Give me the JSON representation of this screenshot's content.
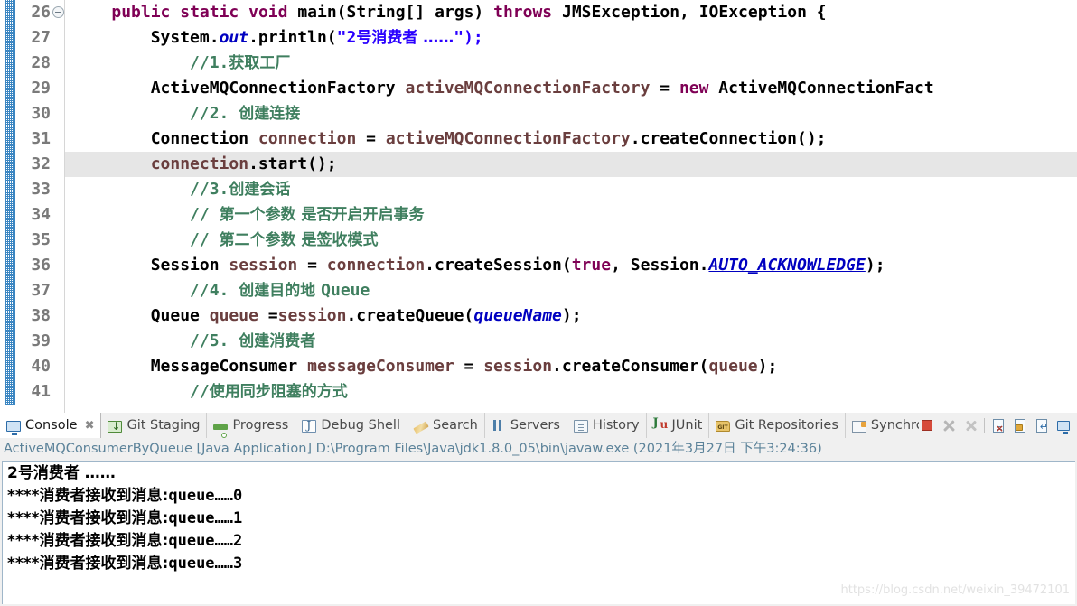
{
  "editor": {
    "lines": [
      {
        "number": "26",
        "folded": true,
        "highlighted": false,
        "tokens": [
          {
            "t": "    ",
            "c": "pln"
          },
          {
            "t": "public",
            "c": "kw"
          },
          {
            "t": " ",
            "c": "pln"
          },
          {
            "t": "static",
            "c": "kw"
          },
          {
            "t": " ",
            "c": "pln"
          },
          {
            "t": "void",
            "c": "kw"
          },
          {
            "t": " ",
            "c": "pln"
          },
          {
            "t": "main",
            "c": "typ"
          },
          {
            "t": "(",
            "c": "pln"
          },
          {
            "t": "String",
            "c": "typ"
          },
          {
            "t": "[] ",
            "c": "pln"
          },
          {
            "t": "args",
            "c": "typ"
          },
          {
            "t": ") ",
            "c": "pln"
          },
          {
            "t": "throws",
            "c": "kw"
          },
          {
            "t": " ",
            "c": "pln"
          },
          {
            "t": "JMSException, IOException {",
            "c": "typ"
          }
        ]
      },
      {
        "number": "27",
        "folded": false,
        "highlighted": false,
        "tokens": [
          {
            "t": "        ",
            "c": "pln"
          },
          {
            "t": "System",
            "c": "typ"
          },
          {
            "t": ".",
            "c": "pln"
          },
          {
            "t": "out",
            "c": "fld"
          },
          {
            "t": ".println(",
            "c": "pln"
          },
          {
            "t": "\"2",
            "c": "str"
          },
          {
            "t": "号消费者 ……",
            "c": "str cn"
          },
          {
            "t": "\");",
            "c": "str"
          }
        ]
      },
      {
        "number": "28",
        "folded": false,
        "highlighted": false,
        "tokens": [
          {
            "t": "            ",
            "c": "pln"
          },
          {
            "t": "//1.",
            "c": "cmt"
          },
          {
            "t": "获取工厂",
            "c": "cmt cn"
          }
        ]
      },
      {
        "number": "29",
        "folded": false,
        "highlighted": false,
        "tokens": [
          {
            "t": "        ",
            "c": "pln"
          },
          {
            "t": "ActiveMQConnectionFactory",
            "c": "typ"
          },
          {
            "t": " ",
            "c": "pln"
          },
          {
            "t": "activeMQConnectionFactory",
            "c": "var"
          },
          {
            "t": " = ",
            "c": "pln"
          },
          {
            "t": "new",
            "c": "kw"
          },
          {
            "t": " ",
            "c": "pln"
          },
          {
            "t": "ActiveMQConnectionFact",
            "c": "typ"
          }
        ]
      },
      {
        "number": "30",
        "folded": false,
        "highlighted": false,
        "tokens": [
          {
            "t": "            ",
            "c": "pln"
          },
          {
            "t": "//2. ",
            "c": "cmt"
          },
          {
            "t": "创建连接",
            "c": "cmt cn"
          }
        ]
      },
      {
        "number": "31",
        "folded": false,
        "highlighted": false,
        "tokens": [
          {
            "t": "        ",
            "c": "pln"
          },
          {
            "t": "Connection",
            "c": "typ"
          },
          {
            "t": " ",
            "c": "pln"
          },
          {
            "t": "connection",
            "c": "var"
          },
          {
            "t": " = ",
            "c": "pln"
          },
          {
            "t": "activeMQConnectionFactory",
            "c": "var"
          },
          {
            "t": ".createConnection();",
            "c": "pln"
          }
        ]
      },
      {
        "number": "32",
        "folded": false,
        "highlighted": true,
        "tokens": [
          {
            "t": "        ",
            "c": "pln"
          },
          {
            "t": "connection",
            "c": "var"
          },
          {
            "t": ".start();",
            "c": "pln"
          }
        ]
      },
      {
        "number": "33",
        "folded": false,
        "highlighted": false,
        "tokens": [
          {
            "t": "            ",
            "c": "pln"
          },
          {
            "t": "//3.",
            "c": "cmt"
          },
          {
            "t": "创建会话",
            "c": "cmt cn"
          }
        ]
      },
      {
        "number": "34",
        "folded": false,
        "highlighted": false,
        "tokens": [
          {
            "t": "            ",
            "c": "pln"
          },
          {
            "t": "// ",
            "c": "cmt"
          },
          {
            "t": "第一个参数 是否开启开启事务",
            "c": "cmt cn"
          }
        ]
      },
      {
        "number": "35",
        "folded": false,
        "highlighted": false,
        "tokens": [
          {
            "t": "            ",
            "c": "pln"
          },
          {
            "t": "// ",
            "c": "cmt"
          },
          {
            "t": "第二个参数 是签收模式",
            "c": "cmt cn"
          }
        ]
      },
      {
        "number": "36",
        "folded": false,
        "highlighted": false,
        "tokens": [
          {
            "t": "        ",
            "c": "pln"
          },
          {
            "t": "Session",
            "c": "typ"
          },
          {
            "t": " ",
            "c": "pln"
          },
          {
            "t": "session",
            "c": "var"
          },
          {
            "t": " = ",
            "c": "pln"
          },
          {
            "t": "connection",
            "c": "var"
          },
          {
            "t": ".createSession(",
            "c": "pln"
          },
          {
            "t": "true",
            "c": "kw"
          },
          {
            "t": ", ",
            "c": "pln"
          },
          {
            "t": "Session",
            "c": "typ"
          },
          {
            "t": ".",
            "c": "pln"
          },
          {
            "t": "AUTO_ACKNOWLEDGE",
            "c": "sfld"
          },
          {
            "t": ");",
            "c": "pln"
          }
        ]
      },
      {
        "number": "37",
        "folded": false,
        "highlighted": false,
        "tokens": [
          {
            "t": "            ",
            "c": "pln"
          },
          {
            "t": "//4. ",
            "c": "cmt"
          },
          {
            "t": "创建目的地 ",
            "c": "cmt cn"
          },
          {
            "t": "Queue",
            "c": "cmt"
          }
        ]
      },
      {
        "number": "38",
        "folded": false,
        "highlighted": false,
        "tokens": [
          {
            "t": "        ",
            "c": "pln"
          },
          {
            "t": "Queue",
            "c": "typ"
          },
          {
            "t": " ",
            "c": "pln"
          },
          {
            "t": "queue",
            "c": "var"
          },
          {
            "t": " =",
            "c": "pln"
          },
          {
            "t": "session",
            "c": "var"
          },
          {
            "t": ".createQueue(",
            "c": "pln"
          },
          {
            "t": "queueName",
            "c": "fld"
          },
          {
            "t": ");",
            "c": "pln"
          }
        ]
      },
      {
        "number": "39",
        "folded": false,
        "highlighted": false,
        "tokens": [
          {
            "t": "            ",
            "c": "pln"
          },
          {
            "t": "//5. ",
            "c": "cmt"
          },
          {
            "t": "创建消费者",
            "c": "cmt cn"
          }
        ]
      },
      {
        "number": "40",
        "folded": false,
        "highlighted": false,
        "tokens": [
          {
            "t": "        ",
            "c": "pln"
          },
          {
            "t": "MessageConsumer",
            "c": "typ"
          },
          {
            "t": " ",
            "c": "pln"
          },
          {
            "t": "messageConsumer",
            "c": "var"
          },
          {
            "t": " = ",
            "c": "pln"
          },
          {
            "t": "session",
            "c": "var"
          },
          {
            "t": ".createConsumer(",
            "c": "pln"
          },
          {
            "t": "queue",
            "c": "var"
          },
          {
            "t": ");",
            "c": "pln"
          }
        ]
      },
      {
        "number": "41",
        "folded": false,
        "highlighted": false,
        "tokens": [
          {
            "t": "            ",
            "c": "pln"
          },
          {
            "t": "//",
            "c": "cmt"
          },
          {
            "t": "使用同步阻塞的方式",
            "c": "cmt cn"
          }
        ]
      }
    ]
  },
  "console_panel": {
    "tabs": [
      {
        "label": "Console",
        "icon": "console-icon",
        "icon_class": "ic-console",
        "active": true,
        "closable": true,
        "close_glyph": "✖"
      },
      {
        "label": "Git Staging",
        "icon": "git-staging-icon",
        "icon_class": "ic-gitstage",
        "active": false,
        "closable": false
      },
      {
        "label": "Progress",
        "icon": "progress-icon",
        "icon_class": "ic-progress",
        "active": false,
        "closable": false
      },
      {
        "label": "Debug Shell",
        "icon": "debug-shell-icon",
        "icon_class": "ic-debugshell",
        "active": false,
        "closable": false
      },
      {
        "label": "Search",
        "icon": "search-icon",
        "icon_class": "ic-search",
        "active": false,
        "closable": false
      },
      {
        "label": "Servers",
        "icon": "servers-icon",
        "icon_class": "ic-servers",
        "active": false,
        "closable": false
      },
      {
        "label": "History",
        "icon": "history-icon",
        "icon_class": "ic-history",
        "active": false,
        "closable": false
      },
      {
        "label": "JUnit",
        "icon": "junit-icon",
        "icon_class": "ic-junit",
        "active": false,
        "closable": false
      },
      {
        "label": "Git Repositories",
        "icon": "git-repositories-icon",
        "icon_class": "ic-gitrepo",
        "active": false,
        "closable": false
      },
      {
        "label": "Synchronize",
        "icon": "synchronize-icon",
        "icon_class": "ic-sync",
        "active": false,
        "closable": false
      }
    ],
    "toolbar": [
      {
        "name": "terminate-button",
        "class": "tb-stop",
        "enabled": true
      },
      {
        "name": "remove-launch-button",
        "class": "tb-x",
        "enabled": false
      },
      {
        "name": "remove-all-terminated-button",
        "class": "tb-xx",
        "enabled": false
      },
      {
        "name": "separator",
        "class": "tb-sep",
        "enabled": false
      },
      {
        "name": "clear-console-button",
        "class": "tb-doc",
        "enabled": true
      },
      {
        "name": "scroll-lock-button",
        "class": "tb-lock",
        "enabled": true
      },
      {
        "name": "pin-console-button",
        "class": "tb-pin",
        "enabled": true
      },
      {
        "name": "display-selected-console-button",
        "class": "tb-display",
        "enabled": true
      }
    ],
    "launch_line": "ActiveMQConsumerByQueue [Java Application] D:\\Program Files\\Java\\jdk1.8.0_05\\bin\\javaw.exe  (2021年3月27日 下午3:24:36)",
    "output_lines": [
      {
        "cn": "2号消费者 ……",
        "ascii": ""
      },
      {
        "cn": "****消费者接收到消息:",
        "ascii": "queue……0"
      },
      {
        "cn": "****消费者接收到消息:",
        "ascii": "queue……1"
      },
      {
        "cn": "****消费者接收到消息:",
        "ascii": "queue……2"
      },
      {
        "cn": "****消费者接收到消息:",
        "ascii": "queue……3"
      }
    ]
  },
  "watermark": {
    "text": "https://blog.csdn.net/weixin_39472101"
  },
  "colors": {
    "keyword": "#7f0055",
    "string": "#2a00ff",
    "comment": "#3f7f5f",
    "field": "#0000c0",
    "local_var": "#6a3e3e",
    "line_number": "#7a7a7a",
    "highlight_row": "#e6e6e6",
    "change_bar": "#1a72b8",
    "launch_line": "#5b8299",
    "panel_bg": "#f0f0f0"
  }
}
